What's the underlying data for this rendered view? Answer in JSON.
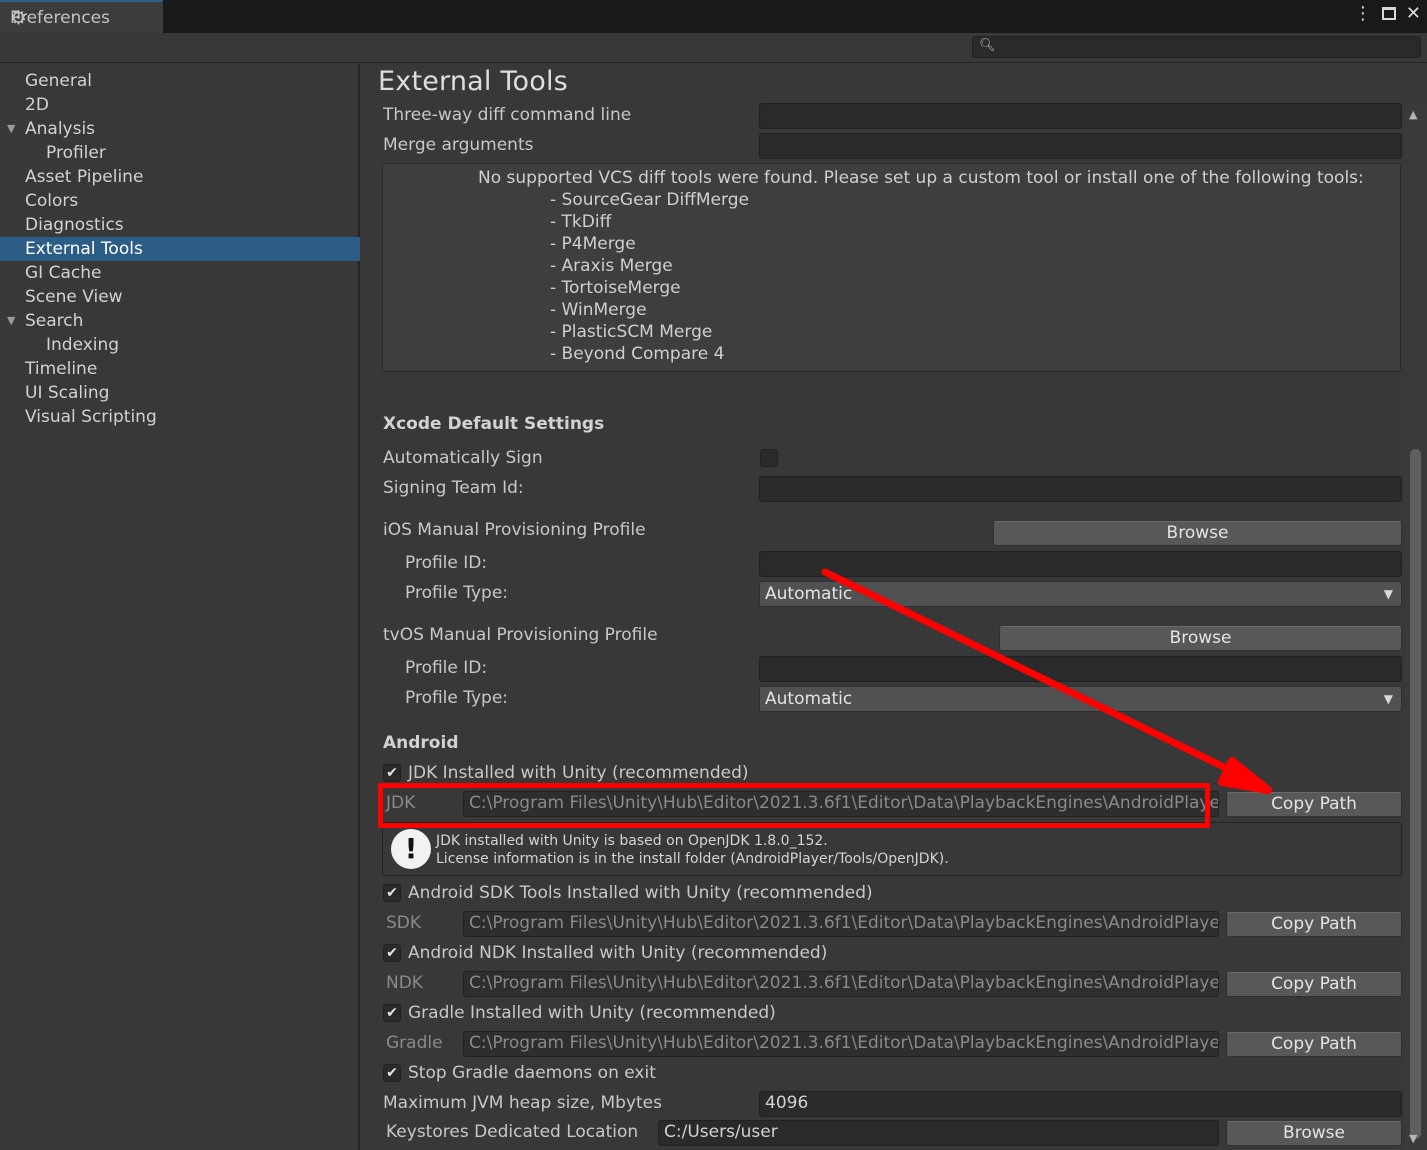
{
  "window": {
    "tab_title": "Preferences",
    "gear_icon": "gear-icon",
    "controls": [
      "more-icon",
      "maximize-icon",
      "close-icon"
    ]
  },
  "search": {
    "placeholder": "",
    "value": ""
  },
  "sidebar": {
    "items": [
      {
        "label": "General",
        "indent": 0,
        "expander": false,
        "selected": false
      },
      {
        "label": "2D",
        "indent": 0,
        "expander": false,
        "selected": false
      },
      {
        "label": "Analysis",
        "indent": 0,
        "expander": true,
        "selected": false
      },
      {
        "label": "Profiler",
        "indent": 1,
        "expander": false,
        "selected": false
      },
      {
        "label": "Asset Pipeline",
        "indent": 0,
        "expander": false,
        "selected": false
      },
      {
        "label": "Colors",
        "indent": 0,
        "expander": false,
        "selected": false
      },
      {
        "label": "Diagnostics",
        "indent": 0,
        "expander": false,
        "selected": false
      },
      {
        "label": "External Tools",
        "indent": 0,
        "expander": false,
        "selected": true
      },
      {
        "label": "GI Cache",
        "indent": 0,
        "expander": false,
        "selected": false
      },
      {
        "label": "Scene View",
        "indent": 0,
        "expander": false,
        "selected": false
      },
      {
        "label": "Search",
        "indent": 0,
        "expander": true,
        "selected": false
      },
      {
        "label": "Indexing",
        "indent": 1,
        "expander": false,
        "selected": false
      },
      {
        "label": "Timeline",
        "indent": 0,
        "expander": false,
        "selected": false
      },
      {
        "label": "UI Scaling",
        "indent": 0,
        "expander": false,
        "selected": false
      },
      {
        "label": "Visual Scripting",
        "indent": 0,
        "expander": false,
        "selected": false
      }
    ]
  },
  "main": {
    "title": "External Tools",
    "three_way_label": "Three-way diff command line",
    "three_way_value": "",
    "merge_label": "Merge arguments",
    "merge_value": "",
    "vcs_message": "No supported VCS diff tools were found. Please set up a custom tool or install one of the following tools:",
    "vcs_tools": [
      "- SourceGear DiffMerge",
      "- TkDiff",
      "- P4Merge",
      "- Araxis Merge",
      "- TortoiseMerge",
      "- WinMerge",
      "- PlasticSCM Merge",
      "- Beyond Compare 4"
    ],
    "xcode": {
      "header": "Xcode Default Settings",
      "auto_sign_label": "Automatically Sign",
      "auto_sign_checked": false,
      "team_id_label": "Signing Team Id:",
      "team_id_value": "",
      "ios_label": "iOS Manual Provisioning Profile",
      "ios_browse": "Browse",
      "ios_profile_id_label": "Profile ID:",
      "ios_profile_id_value": "",
      "ios_profile_type_label": "Profile Type:",
      "ios_profile_type_value": "Automatic",
      "tvos_label": "tvOS Manual Provisioning Profile",
      "tvos_browse": "Browse",
      "tvos_profile_id_label": "Profile ID:",
      "tvos_profile_id_value": "",
      "tvos_profile_type_label": "Profile Type:",
      "tvos_profile_type_value": "Automatic"
    },
    "android": {
      "header": "Android",
      "jdk_check_label": "JDK Installed with Unity (recommended)",
      "jdk_label": "JDK",
      "jdk_path": "C:\\Program Files\\Unity\\Hub\\Editor\\2021.3.6f1\\Editor\\Data\\PlaybackEngines\\AndroidPlayer\\OpenJDK",
      "jdk_copy": "Copy Path",
      "info_line1": "JDK installed with Unity is based on OpenJDK 1.8.0_152.",
      "info_line2": "License information is in the install folder (AndroidPlayer/Tools/OpenJDK).",
      "sdk_check_label": "Android SDK Tools Installed with Unity (recommended)",
      "sdk_label": "SDK",
      "sdk_path": "C:\\Program Files\\Unity\\Hub\\Editor\\2021.3.6f1\\Editor\\Data\\PlaybackEngines\\AndroidPlayer\\SDK",
      "sdk_copy": "Copy Path",
      "ndk_check_label": "Android NDK Installed with Unity (recommended)",
      "ndk_label": "NDK",
      "ndk_path": "C:\\Program Files\\Unity\\Hub\\Editor\\2021.3.6f1\\Editor\\Data\\PlaybackEngines\\AndroidPlayer\\NDK",
      "ndk_copy": "Copy Path",
      "gradle_check_label": "Gradle Installed with Unity (recommended)",
      "gradle_label": "Gradle",
      "gradle_path": "C:\\Program Files\\Unity\\Hub\\Editor\\2021.3.6f1\\Editor\\Data\\PlaybackEngines\\AndroidPlayer\\Tools\\gradle",
      "gradle_copy": "Copy Path",
      "stop_gradle_label": "Stop Gradle daemons on exit",
      "jvm_label": "Maximum JVM heap size, Mbytes",
      "jvm_value": "4096",
      "keystore_label": "Keystores Dedicated Location",
      "keystore_value": "C:/Users/user",
      "keystore_browse": "Browse"
    }
  },
  "annotation_color": "#ff0000"
}
